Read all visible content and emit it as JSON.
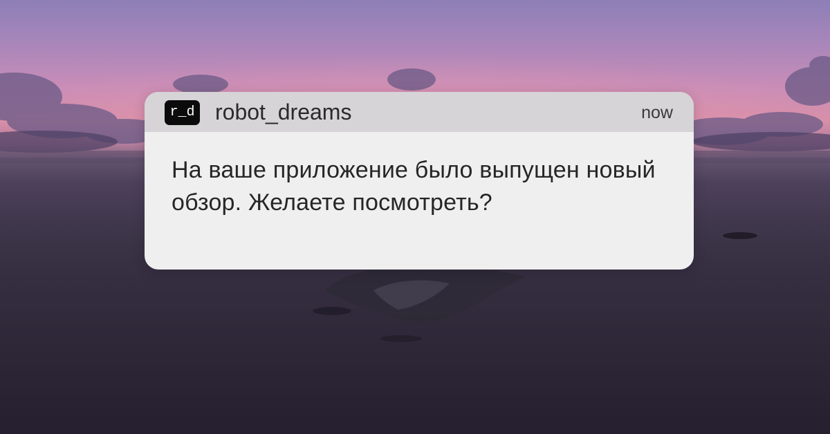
{
  "wallpaper": {
    "description_colors": [
      "#8d7fb7",
      "#d88fa8",
      "#3c3548",
      "#261f2f"
    ]
  },
  "notification": {
    "app_icon_text": "r_d",
    "app_name": "robot_dreams",
    "timestamp": "now",
    "message": "На ваше приложение было выпущен новый обзор. Желаете посмотреть?",
    "colors": {
      "header_bg": "#d6d4d6",
      "body_bg": "#efefef",
      "icon_bg": "#0b0b0b"
    }
  }
}
